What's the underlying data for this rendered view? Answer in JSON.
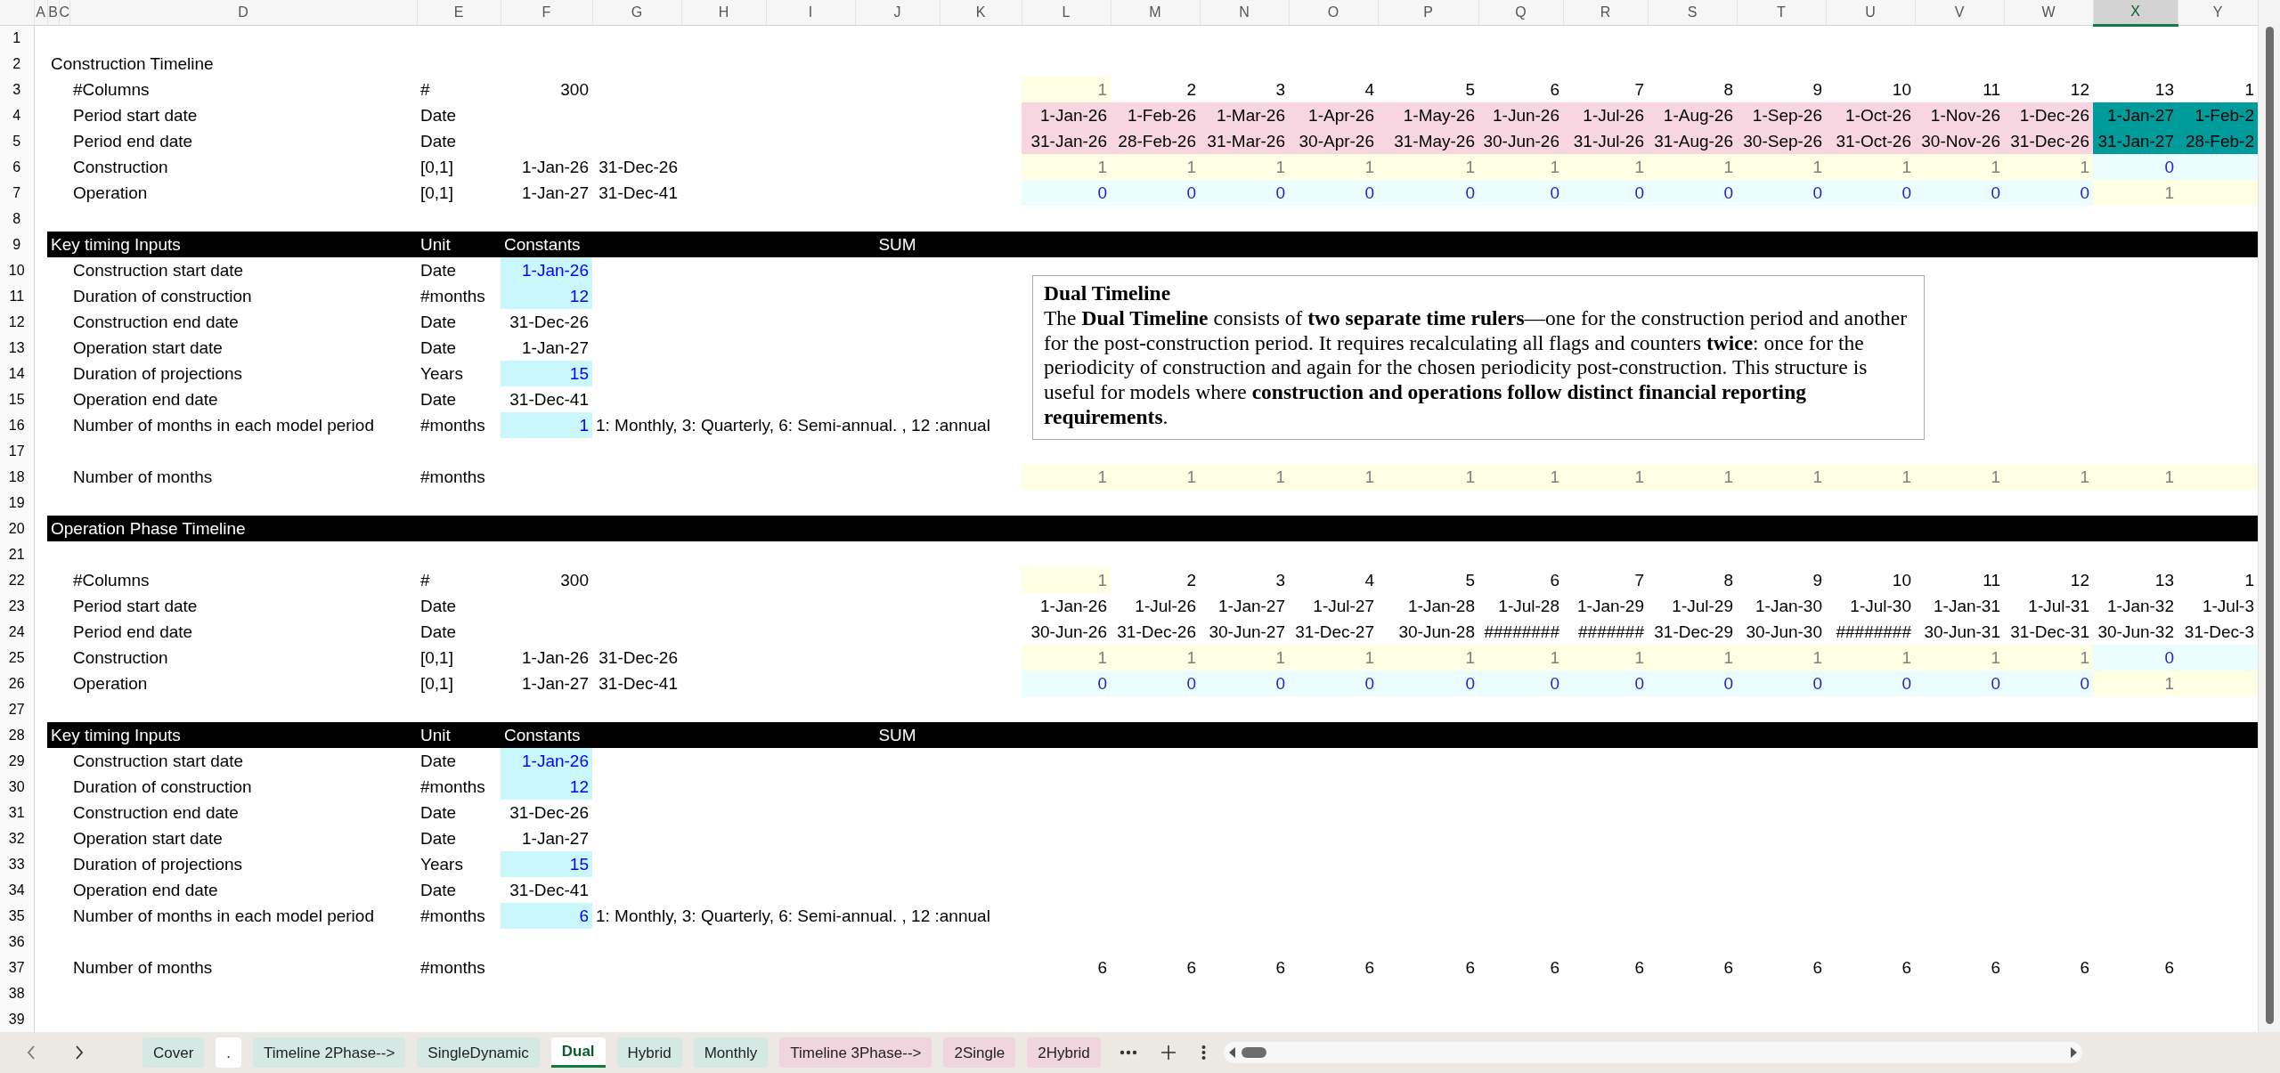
{
  "column_headers": [
    {
      "label": "A",
      "selected": false
    },
    {
      "label": "B",
      "selected": false
    },
    {
      "label": "C",
      "selected": false
    },
    {
      "label": "D",
      "selected": false
    },
    {
      "label": "E",
      "selected": false
    },
    {
      "label": "F",
      "selected": false
    },
    {
      "label": "G",
      "selected": false
    },
    {
      "label": "H",
      "selected": false
    },
    {
      "label": "I",
      "selected": false
    },
    {
      "label": "J",
      "selected": false
    },
    {
      "label": "K",
      "selected": false
    },
    {
      "label": "L",
      "selected": false
    },
    {
      "label": "M",
      "selected": false
    },
    {
      "label": "N",
      "selected": false
    },
    {
      "label": "O",
      "selected": false
    },
    {
      "label": "P",
      "selected": false
    },
    {
      "label": "Q",
      "selected": false
    },
    {
      "label": "R",
      "selected": false
    },
    {
      "label": "S",
      "selected": false
    },
    {
      "label": "T",
      "selected": false
    },
    {
      "label": "U",
      "selected": false
    },
    {
      "label": "V",
      "selected": false
    },
    {
      "label": "W",
      "selected": false
    },
    {
      "label": "X",
      "selected": true
    },
    {
      "label": "Y",
      "selected": false
    }
  ],
  "rows": [
    {
      "number": "1"
    },
    {
      "number": "2",
      "title": "Construction Timeline"
    },
    {
      "number": "3",
      "label": "#Columns",
      "unit": "#",
      "value": {
        "text": "300",
        "kind": "value"
      },
      "timeline": [
        {
          "text": "1",
          "kind": "on"
        },
        {
          "text": "2",
          "kind": "value"
        },
        {
          "text": "3",
          "kind": "value"
        },
        {
          "text": "4",
          "kind": "value"
        },
        {
          "text": "5",
          "kind": "value"
        },
        {
          "text": "6",
          "kind": "value"
        },
        {
          "text": "7",
          "kind": "value"
        },
        {
          "text": "8",
          "kind": "value"
        },
        {
          "text": "9",
          "kind": "value"
        },
        {
          "text": "10",
          "kind": "value"
        },
        {
          "text": "11",
          "kind": "value"
        },
        {
          "text": "12",
          "kind": "value"
        },
        {
          "text": "13",
          "kind": "value"
        },
        {
          "text": "1",
          "kind": "value"
        }
      ]
    },
    {
      "number": "4",
      "label": "Period start date",
      "unit": "Date",
      "timeline": [
        {
          "text": "1-Jan-26",
          "kind": "period"
        },
        {
          "text": "1-Feb-26",
          "kind": "period"
        },
        {
          "text": "1-Mar-26",
          "kind": "period"
        },
        {
          "text": "1-Apr-26",
          "kind": "period"
        },
        {
          "text": "1-May-26",
          "kind": "period"
        },
        {
          "text": "1-Jun-26",
          "kind": "period"
        },
        {
          "text": "1-Jul-26",
          "kind": "period"
        },
        {
          "text": "1-Aug-26",
          "kind": "period"
        },
        {
          "text": "1-Sep-26",
          "kind": "period"
        },
        {
          "text": "1-Oct-26",
          "kind": "period"
        },
        {
          "text": "1-Nov-26",
          "kind": "period"
        },
        {
          "text": "1-Dec-26",
          "kind": "period"
        },
        {
          "text": "1-Jan-27",
          "kind": "period-current"
        },
        {
          "text": "1-Feb-2",
          "kind": "period-current"
        }
      ]
    },
    {
      "number": "5",
      "label": "Period end date",
      "unit": "Date",
      "timeline": [
        {
          "text": "31-Jan-26",
          "kind": "period"
        },
        {
          "text": "28-Feb-26",
          "kind": "period"
        },
        {
          "text": "31-Mar-26",
          "kind": "period"
        },
        {
          "text": "30-Apr-26",
          "kind": "period"
        },
        {
          "text": "31-May-26",
          "kind": "period"
        },
        {
          "text": "30-Jun-26",
          "kind": "period"
        },
        {
          "text": "31-Jul-26",
          "kind": "period"
        },
        {
          "text": "31-Aug-26",
          "kind": "period"
        },
        {
          "text": "30-Sep-26",
          "kind": "period"
        },
        {
          "text": "31-Oct-26",
          "kind": "period"
        },
        {
          "text": "30-Nov-26",
          "kind": "period"
        },
        {
          "text": "31-Dec-26",
          "kind": "period"
        },
        {
          "text": "31-Jan-27",
          "kind": "period-current"
        },
        {
          "text": "28-Feb-2",
          "kind": "period-current"
        }
      ]
    },
    {
      "number": "6",
      "label": "Construction",
      "unit": "[0,1]",
      "value": {
        "text": "1-Jan-26",
        "kind": "value"
      },
      "end": "31-Dec-26",
      "timeline": [
        {
          "text": "1",
          "kind": "on"
        },
        {
          "text": "1",
          "kind": "on"
        },
        {
          "text": "1",
          "kind": "on"
        },
        {
          "text": "1",
          "kind": "on"
        },
        {
          "text": "1",
          "kind": "on"
        },
        {
          "text": "1",
          "kind": "on"
        },
        {
          "text": "1",
          "kind": "on"
        },
        {
          "text": "1",
          "kind": "on"
        },
        {
          "text": "1",
          "kind": "on"
        },
        {
          "text": "1",
          "kind": "on"
        },
        {
          "text": "1",
          "kind": "on"
        },
        {
          "text": "1",
          "kind": "on"
        },
        {
          "text": "0",
          "kind": "off"
        },
        {
          "kind": "off"
        }
      ]
    },
    {
      "number": "7",
      "label": "Operation",
      "unit": "[0,1]",
      "value": {
        "text": "1-Jan-27",
        "kind": "value"
      },
      "end": "31-Dec-41",
      "timeline": [
        {
          "text": "0",
          "kind": "off"
        },
        {
          "text": "0",
          "kind": "off"
        },
        {
          "text": "0",
          "kind": "off"
        },
        {
          "text": "0",
          "kind": "off"
        },
        {
          "text": "0",
          "kind": "off"
        },
        {
          "text": "0",
          "kind": "off"
        },
        {
          "text": "0",
          "kind": "off"
        },
        {
          "text": "0",
          "kind": "off"
        },
        {
          "text": "0",
          "kind": "off"
        },
        {
          "text": "0",
          "kind": "off"
        },
        {
          "text": "0",
          "kind": "off"
        },
        {
          "text": "0",
          "kind": "off"
        },
        {
          "text": "1",
          "kind": "on"
        },
        {
          "kind": "on"
        }
      ]
    },
    {
      "number": "8"
    },
    {
      "number": "9",
      "band": true,
      "title": "Key timing Inputs",
      "unit_heading": "Unit",
      "constants_heading": "Constants",
      "sum_heading": "SUM"
    },
    {
      "number": "10",
      "label": "Construction start date",
      "unit": "Date",
      "value": {
        "text": "1-Jan-26",
        "kind": "input"
      }
    },
    {
      "number": "11",
      "label": "Duration of construction",
      "unit": "#months",
      "value": {
        "text": "12",
        "kind": "input"
      }
    },
    {
      "number": "12",
      "label": "Construction end date",
      "unit": "Date",
      "value": {
        "text": "31-Dec-26",
        "kind": "value"
      }
    },
    {
      "number": "13",
      "label": "Operation start date",
      "unit": "Date",
      "value": {
        "text": "1-Jan-27",
        "kind": "value"
      }
    },
    {
      "number": "14",
      "label": "Duration of projections",
      "unit": "Years",
      "value": {
        "text": "15",
        "kind": "input"
      }
    },
    {
      "number": "15",
      "label": "Operation end date",
      "unit": "Date",
      "value": {
        "text": "31-Dec-41",
        "kind": "value"
      }
    },
    {
      "number": "16",
      "label": "Number of months in each model period",
      "unit": "#months",
      "value": {
        "text": "1",
        "kind": "input"
      },
      "note": "1: Monthly, 3: Quarterly, 6: Semi-annual. , 12 :annual"
    },
    {
      "number": "17"
    },
    {
      "number": "18",
      "label": "Number of months",
      "unit": "#months",
      "timeline": [
        {
          "text": "1",
          "kind": "on"
        },
        {
          "text": "1",
          "kind": "on"
        },
        {
          "text": "1",
          "kind": "on"
        },
        {
          "text": "1",
          "kind": "on"
        },
        {
          "text": "1",
          "kind": "on"
        },
        {
          "text": "1",
          "kind": "on"
        },
        {
          "text": "1",
          "kind": "on"
        },
        {
          "text": "1",
          "kind": "on"
        },
        {
          "text": "1",
          "kind": "on"
        },
        {
          "text": "1",
          "kind": "on"
        },
        {
          "text": "1",
          "kind": "on"
        },
        {
          "text": "1",
          "kind": "on"
        },
        {
          "text": "1",
          "kind": "on"
        },
        {
          "kind": "on"
        }
      ]
    },
    {
      "number": "19"
    },
    {
      "number": "20",
      "band": true,
      "title": "Operation Phase Timeline"
    },
    {
      "number": "21"
    },
    {
      "number": "22",
      "label": "#Columns",
      "unit": "#",
      "value": {
        "text": "300",
        "kind": "value"
      },
      "timeline": [
        {
          "text": "1",
          "kind": "on"
        },
        {
          "text": "2",
          "kind": "value"
        },
        {
          "text": "3",
          "kind": "value"
        },
        {
          "text": "4",
          "kind": "value"
        },
        {
          "text": "5",
          "kind": "value"
        },
        {
          "text": "6",
          "kind": "value"
        },
        {
          "text": "7",
          "kind": "value"
        },
        {
          "text": "8",
          "kind": "value"
        },
        {
          "text": "9",
          "kind": "value"
        },
        {
          "text": "10",
          "kind": "value"
        },
        {
          "text": "11",
          "kind": "value"
        },
        {
          "text": "12",
          "kind": "value"
        },
        {
          "text": "13",
          "kind": "value"
        },
        {
          "text": "1",
          "kind": "value"
        }
      ]
    },
    {
      "number": "23",
      "label": "Period start date",
      "unit": "Date",
      "timeline": [
        {
          "text": "1-Jan-26",
          "kind": "value"
        },
        {
          "text": "1-Jul-26",
          "kind": "value"
        },
        {
          "text": "1-Jan-27",
          "kind": "value"
        },
        {
          "text": "1-Jul-27",
          "kind": "value"
        },
        {
          "text": "1-Jan-28",
          "kind": "value"
        },
        {
          "text": "1-Jul-28",
          "kind": "value"
        },
        {
          "text": "1-Jan-29",
          "kind": "value"
        },
        {
          "text": "1-Jul-29",
          "kind": "value"
        },
        {
          "text": "1-Jan-30",
          "kind": "value"
        },
        {
          "text": "1-Jul-30",
          "kind": "value"
        },
        {
          "text": "1-Jan-31",
          "kind": "value"
        },
        {
          "text": "1-Jul-31",
          "kind": "value"
        },
        {
          "text": "1-Jan-32",
          "kind": "value"
        },
        {
          "text": "1-Jul-3",
          "kind": "value"
        }
      ]
    },
    {
      "number": "24",
      "label": "Period end date",
      "unit": "Date",
      "timeline": [
        {
          "text": "30-Jun-26",
          "kind": "value"
        },
        {
          "text": "31-Dec-26",
          "kind": "value"
        },
        {
          "text": "30-Jun-27",
          "kind": "value"
        },
        {
          "text": "31-Dec-27",
          "kind": "value"
        },
        {
          "text": "30-Jun-28",
          "kind": "value"
        },
        {
          "text": "########",
          "kind": "value"
        },
        {
          "text": "#######",
          "kind": "value"
        },
        {
          "text": "31-Dec-29",
          "kind": "value"
        },
        {
          "text": "30-Jun-30",
          "kind": "value"
        },
        {
          "text": "########",
          "kind": "value"
        },
        {
          "text": "30-Jun-31",
          "kind": "value"
        },
        {
          "text": "31-Dec-31",
          "kind": "value"
        },
        {
          "text": "30-Jun-32",
          "kind": "value"
        },
        {
          "text": "31-Dec-3",
          "kind": "value"
        }
      ]
    },
    {
      "number": "25",
      "label": "Construction",
      "unit": "[0,1]",
      "value": {
        "text": "1-Jan-26",
        "kind": "value"
      },
      "end": "31-Dec-26",
      "timeline": [
        {
          "text": "1",
          "kind": "on"
        },
        {
          "text": "1",
          "kind": "on"
        },
        {
          "text": "1",
          "kind": "on"
        },
        {
          "text": "1",
          "kind": "on"
        },
        {
          "text": "1",
          "kind": "on"
        },
        {
          "text": "1",
          "kind": "on"
        },
        {
          "text": "1",
          "kind": "on"
        },
        {
          "text": "1",
          "kind": "on"
        },
        {
          "text": "1",
          "kind": "on"
        },
        {
          "text": "1",
          "kind": "on"
        },
        {
          "text": "1",
          "kind": "on"
        },
        {
          "text": "1",
          "kind": "on"
        },
        {
          "text": "0",
          "kind": "off"
        },
        {
          "kind": "off"
        }
      ]
    },
    {
      "number": "26",
      "label": "Operation",
      "unit": "[0,1]",
      "value": {
        "text": "1-Jan-27",
        "kind": "value"
      },
      "end": "31-Dec-41",
      "timeline": [
        {
          "text": "0",
          "kind": "off"
        },
        {
          "text": "0",
          "kind": "off"
        },
        {
          "text": "0",
          "kind": "off"
        },
        {
          "text": "0",
          "kind": "off"
        },
        {
          "text": "0",
          "kind": "off"
        },
        {
          "text": "0",
          "kind": "off"
        },
        {
          "text": "0",
          "kind": "off"
        },
        {
          "text": "0",
          "kind": "off"
        },
        {
          "text": "0",
          "kind": "off"
        },
        {
          "text": "0",
          "kind": "off"
        },
        {
          "text": "0",
          "kind": "off"
        },
        {
          "text": "0",
          "kind": "off"
        },
        {
          "text": "1",
          "kind": "on"
        },
        {
          "kind": "on"
        }
      ]
    },
    {
      "number": "27"
    },
    {
      "number": "28",
      "band": true,
      "title": "Key timing Inputs",
      "unit_heading": "Unit",
      "constants_heading": "Constants",
      "sum_heading": "SUM"
    },
    {
      "number": "29",
      "label": "Construction start date",
      "unit": "Date",
      "value": {
        "text": "1-Jan-26",
        "kind": "input"
      }
    },
    {
      "number": "30",
      "label": "Duration of construction",
      "unit": "#months",
      "value": {
        "text": "12",
        "kind": "input"
      }
    },
    {
      "number": "31",
      "label": "Construction end date",
      "unit": "Date",
      "value": {
        "text": "31-Dec-26",
        "kind": "value"
      }
    },
    {
      "number": "32",
      "label": "Operation start date",
      "unit": "Date",
      "value": {
        "text": "1-Jan-27",
        "kind": "value"
      }
    },
    {
      "number": "33",
      "label": "Duration of projections",
      "unit": "Years",
      "value": {
        "text": "15",
        "kind": "input"
      }
    },
    {
      "number": "34",
      "label": "Operation end date",
      "unit": "Date",
      "value": {
        "text": "31-Dec-41",
        "kind": "value"
      }
    },
    {
      "number": "35",
      "label": "Number of months in each model period",
      "unit": "#months",
      "value": {
        "text": "6",
        "kind": "input"
      },
      "note": "1: Monthly, 3: Quarterly, 6: Semi-annual. , 12 :annual"
    },
    {
      "number": "36"
    },
    {
      "number": "37",
      "label": "Number of months",
      "unit": "#months",
      "timeline": [
        {
          "text": "6",
          "kind": "value"
        },
        {
          "text": "6",
          "kind": "value"
        },
        {
          "text": "6",
          "kind": "value"
        },
        {
          "text": "6",
          "kind": "value"
        },
        {
          "text": "6",
          "kind": "value"
        },
        {
          "text": "6",
          "kind": "value"
        },
        {
          "text": "6",
          "kind": "value"
        },
        {
          "text": "6",
          "kind": "value"
        },
        {
          "text": "6",
          "kind": "value"
        },
        {
          "text": "6",
          "kind": "value"
        },
        {
          "text": "6",
          "kind": "value"
        },
        {
          "text": "6",
          "kind": "value"
        },
        {
          "text": "6",
          "kind": "value"
        }
      ]
    },
    {
      "number": "38"
    },
    {
      "number": "39"
    }
  ],
  "text_box": {
    "title": "Dual Timeline",
    "body": "The **Dual Timeline** consists of **two separate time rulers**—one for the construction period and another for the post-construction period. It requires recalculating all flags and counters **twice**: once for the periodicity of construction and again for the chosen periodicity post-construction. This structure is useful for models where **construction and operations follow distinct financial reporting requirements**."
  },
  "sheet_tabs": [
    {
      "label": "Cover",
      "selected": false,
      "color": "#d5e9e4"
    },
    {
      "label": ".",
      "selected": false,
      "color": "#ffffff"
    },
    {
      "label": "Timeline 2Phase-->",
      "selected": false,
      "color": "#d5e9e4"
    },
    {
      "label": "SingleDynamic",
      "selected": false,
      "color": "#d5e9e4"
    },
    {
      "label": "Dual",
      "selected": true,
      "color": "#ffffff"
    },
    {
      "label": "Hybrid",
      "selected": false,
      "color": "#d5e9e4"
    },
    {
      "label": "Monthly",
      "selected": false,
      "color": "#d5e9e4"
    },
    {
      "label": "Timeline 3Phase-->",
      "selected": false,
      "color": "#f0d5de"
    },
    {
      "label": "2Single",
      "selected": false,
      "color": "#f0d5de"
    },
    {
      "label": "2Hybrid",
      "selected": false,
      "color": "#f0d5de"
    }
  ]
}
